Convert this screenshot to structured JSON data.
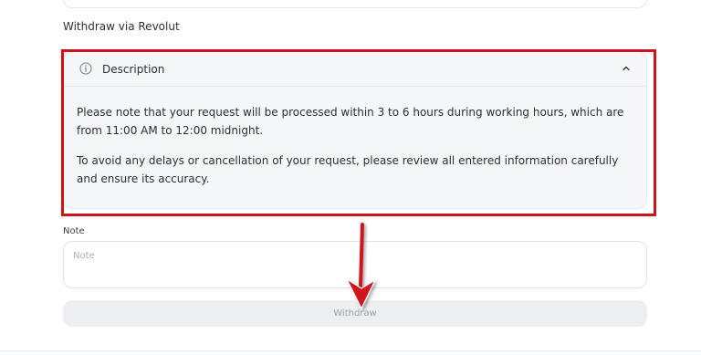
{
  "section": {
    "title": "Withdraw via Revolut"
  },
  "description": {
    "title": "Description",
    "paragraphs": [
      "Please note that your request will be processed within 3 to 6 hours during working hours, which are from 11:00 AM to 12:00 midnight.",
      "To avoid any delays or cancellation of your request, please review all entered information carefully and ensure its accuracy."
    ],
    "expanded": true
  },
  "note": {
    "label": "Note",
    "placeholder": "Note",
    "value": ""
  },
  "actions": {
    "withdraw_label": "Withdraw"
  },
  "icons": {
    "description": "info-icon",
    "toggle": "chevron-up-icon"
  },
  "colors": {
    "highlight": "#d0121b",
    "card_bg": "#f5f6f8",
    "button_bg": "#eceef1",
    "button_text": "#9aa0a8"
  }
}
